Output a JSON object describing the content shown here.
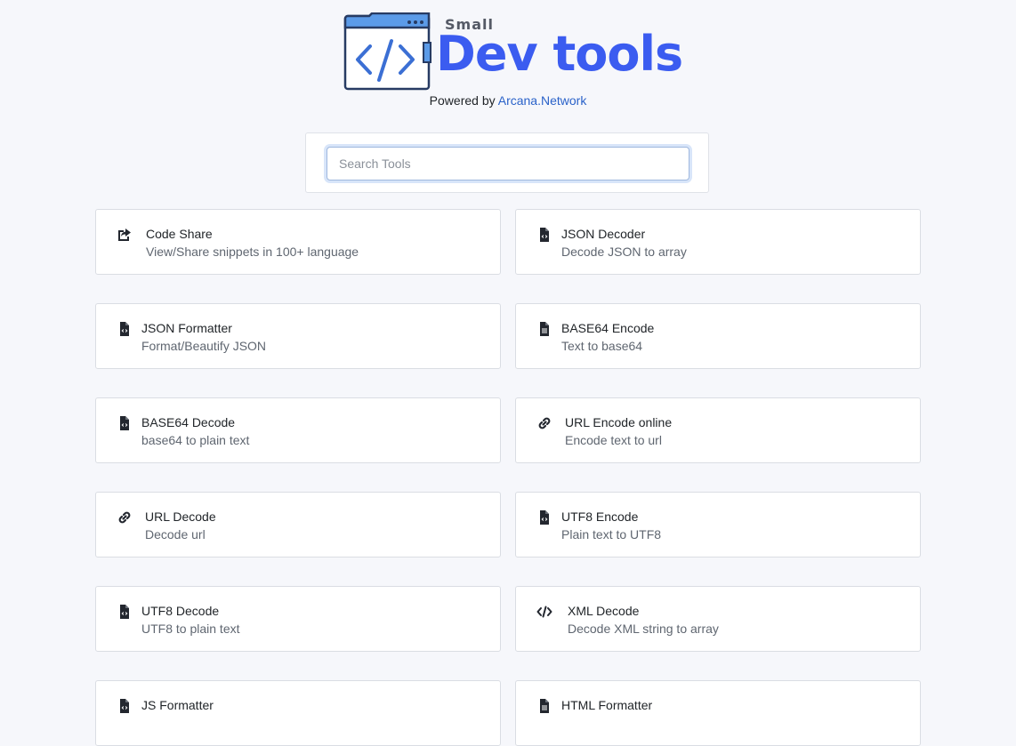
{
  "logo": {
    "small": "Small",
    "big": "Dev tools"
  },
  "powered": {
    "prefix": "Powered by",
    "link": "Arcana.Network"
  },
  "search": {
    "placeholder": "Search Tools",
    "value": ""
  },
  "tools": [
    {
      "title": "Code Share",
      "desc": "View/Share snippets in 100+ language",
      "icon": "share-icon"
    },
    {
      "title": "JSON Decoder",
      "desc": "Decode JSON to array",
      "icon": "file-code-icon"
    },
    {
      "title": "JSON Formatter",
      "desc": "Format/Beautify JSON",
      "icon": "file-code-icon"
    },
    {
      "title": "BASE64 Encode",
      "desc": "Text to base64",
      "icon": "file-text-icon"
    },
    {
      "title": "BASE64 Decode",
      "desc": "base64 to plain text",
      "icon": "file-code-icon"
    },
    {
      "title": "URL Encode online",
      "desc": "Encode text to url",
      "icon": "link-icon"
    },
    {
      "title": "URL Decode",
      "desc": "Decode url",
      "icon": "link-icon"
    },
    {
      "title": "UTF8 Encode",
      "desc": "Plain text to UTF8",
      "icon": "file-code-icon"
    },
    {
      "title": "UTF8 Decode",
      "desc": "UTF8 to plain text",
      "icon": "file-code-icon"
    },
    {
      "title": "XML Decode",
      "desc": "Decode XML string to array",
      "icon": "code-icon"
    },
    {
      "title": "JS Formatter",
      "desc": "",
      "icon": "file-code-icon"
    },
    {
      "title": "HTML Formatter",
      "desc": "",
      "icon": "file-text-icon"
    }
  ]
}
